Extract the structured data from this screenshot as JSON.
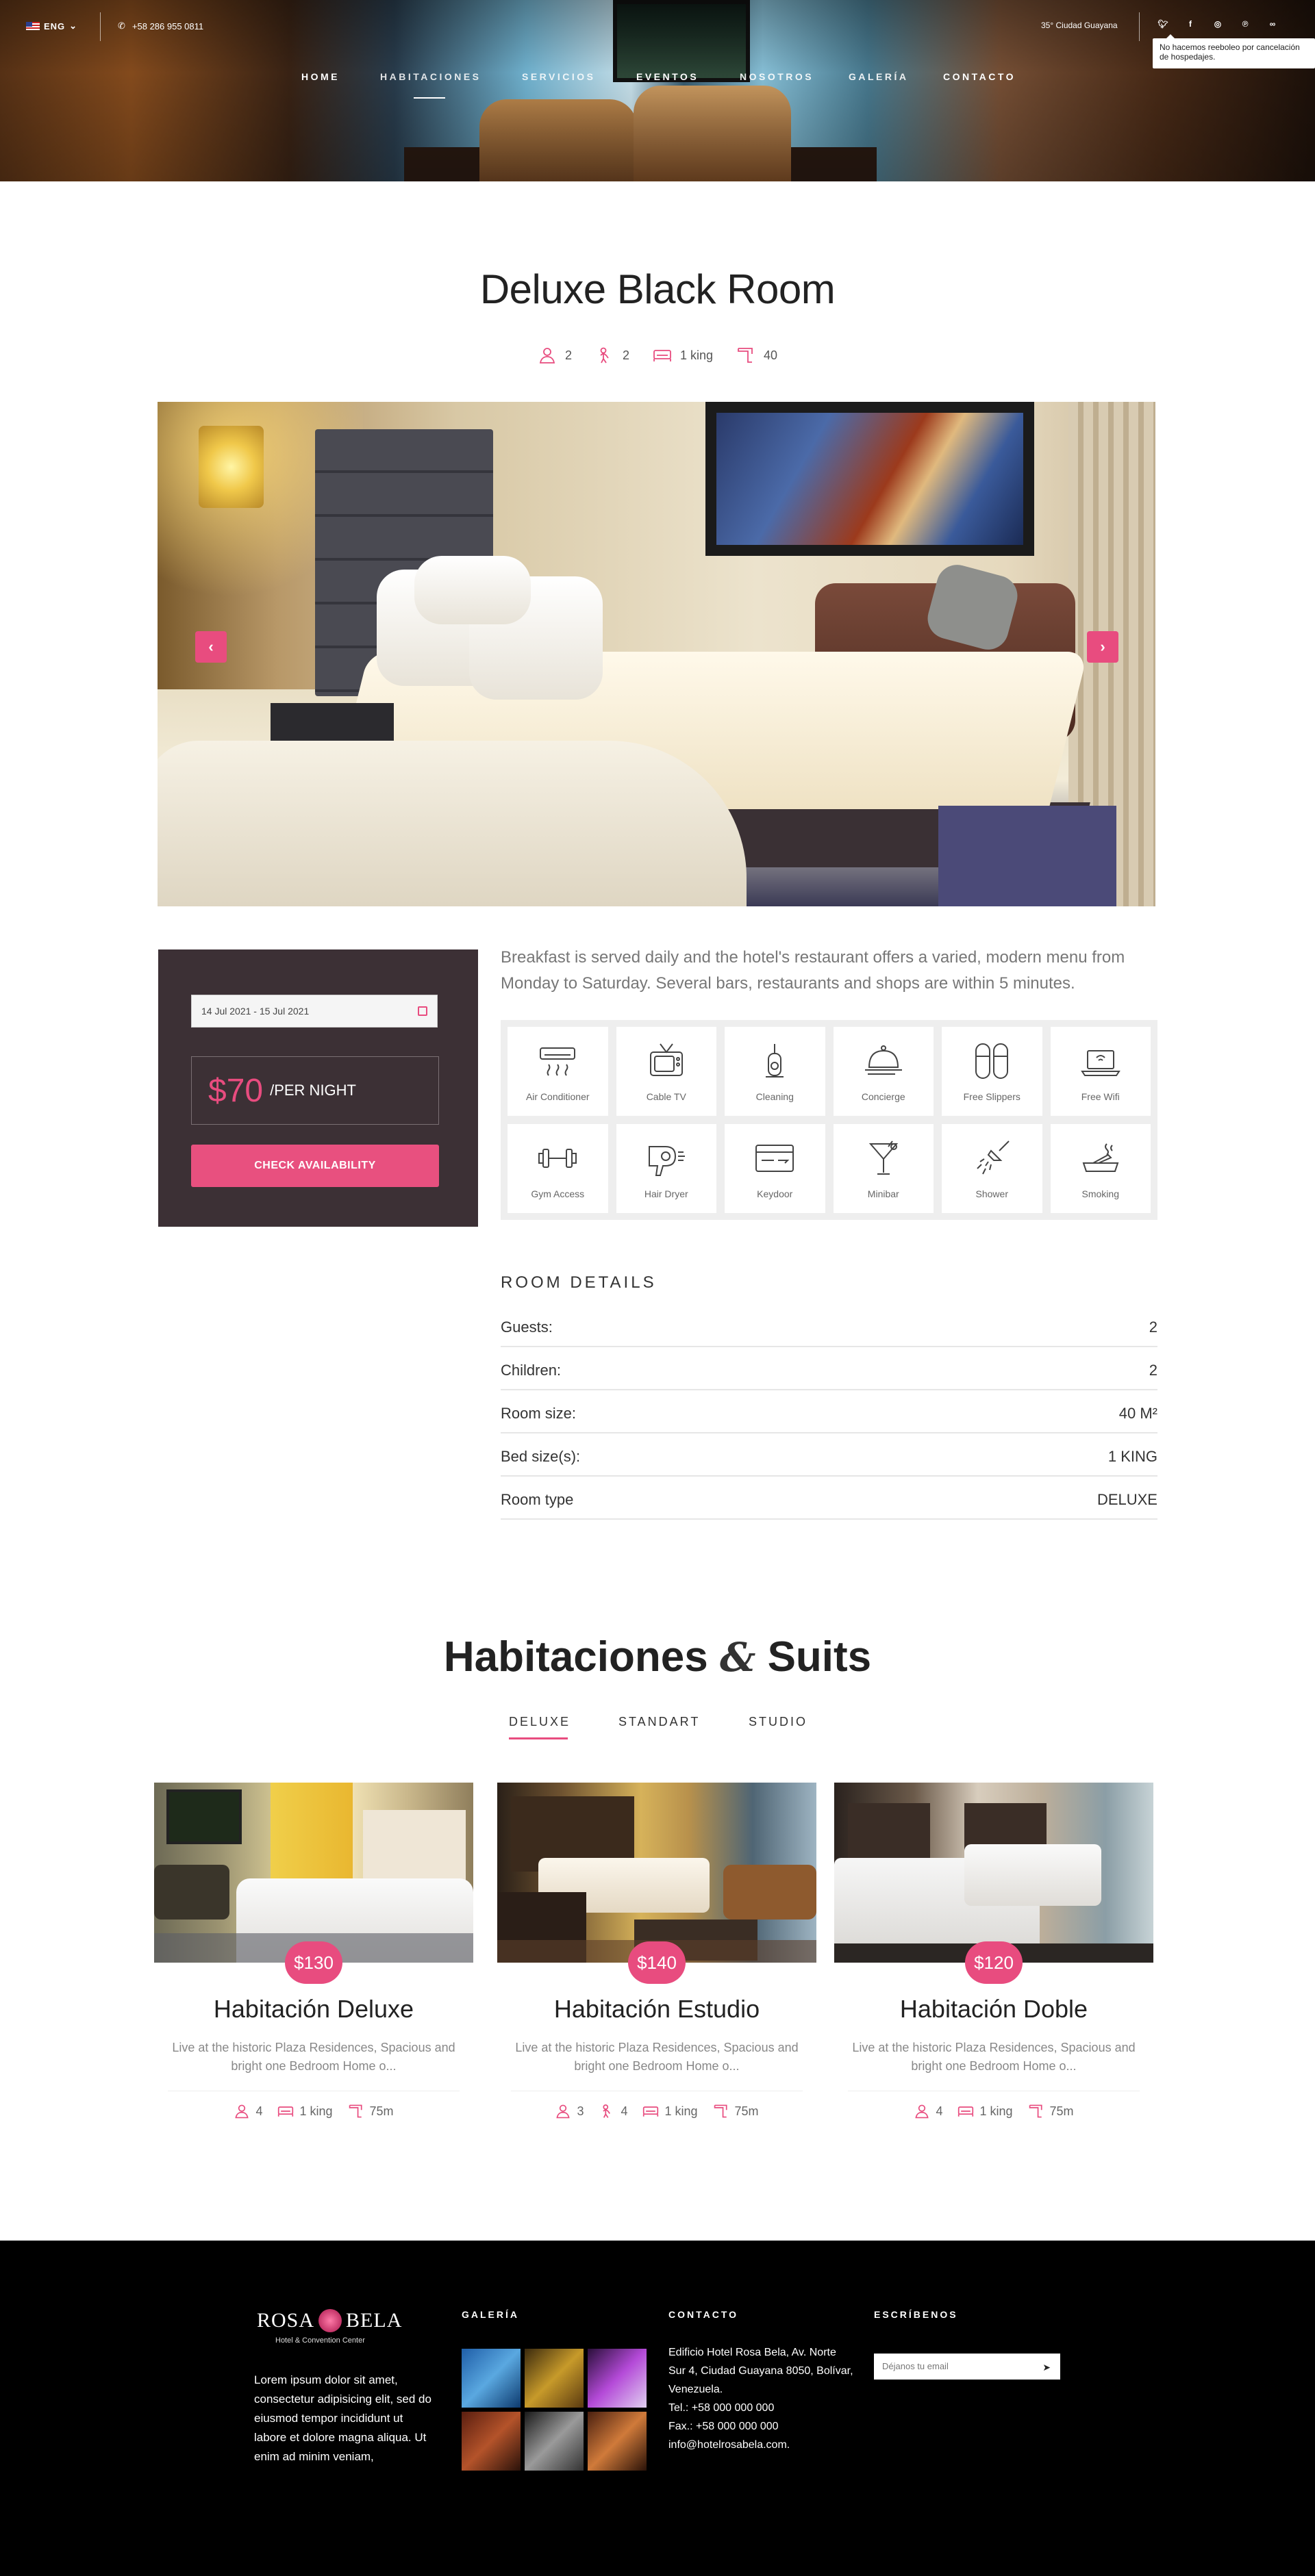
{
  "header": {
    "language": "ENG",
    "phone": "+58 286 955 0811",
    "weather": "35° Ciudad Guayana",
    "socials": [
      "twitter",
      "facebook",
      "instagram",
      "pinterest",
      "tripadvisor"
    ],
    "notice": "No hacemos reeboleo por cancelación de hospedajes.",
    "nav": [
      "HOME",
      "HABITACIONES",
      "SERVICIOS",
      "EVENTOS",
      "NOSOTROS",
      "GALERÍA",
      "CONTACTO"
    ],
    "active_nav": "HABITACIONES"
  },
  "room": {
    "title": "Deluxe Black Room",
    "guests": "2",
    "children": "2",
    "bed": "1 king",
    "size": "40"
  },
  "booking": {
    "date_range": "14 Jul 2021 - 15 Jul 2021",
    "price": "$70",
    "per_night": "/PER NIGHT",
    "button": "CHECK AVAILABILITY"
  },
  "description": "Breakfast is served daily and the hotel's restaurant offers a varied, modern menu from Monday to Saturday. Several bars, restaurants and shops are within 5 minutes.",
  "amenities": [
    "Air Conditioner",
    "Cable TV",
    "Cleaning",
    "Concierge",
    "Free Slippers",
    "Free Wifi",
    "Gym Access",
    "Hair Dryer",
    "Keydoor",
    "Minibar",
    "Shower",
    "Smoking"
  ],
  "room_details": {
    "title": "ROOM DETAILS",
    "rows": [
      {
        "label": "Guests:",
        "value": "2"
      },
      {
        "label": "Children:",
        "value": "2"
      },
      {
        "label": "Room size:",
        "value": "40 M²"
      },
      {
        "label": "Bed size(s):",
        "value": "1 KING"
      },
      {
        "label": "Room type",
        "value": "DELUXE"
      }
    ]
  },
  "rooms_section": {
    "title_a": "Habitaciones",
    "amp": "&",
    "title_b": "Suits",
    "tabs": [
      "DELUXE",
      "STANDART",
      "STUDIO"
    ],
    "cards": [
      {
        "price": "$130",
        "name": "Habitación Deluxe",
        "desc": "Live at the historic Plaza Residences, Spacious and bright one Bedroom Home o...",
        "guests": "4",
        "children": "",
        "bed": "1 king",
        "size": "75m"
      },
      {
        "price": "$140",
        "name": "Habitación Estudio",
        "desc": "Live at the historic Plaza Residences, Spacious and bright one Bedroom Home o...",
        "guests": "3",
        "children": "4",
        "bed": "1 king",
        "size": "75m"
      },
      {
        "price": "$120",
        "name": "Habitación  Doble",
        "desc": "Live at the historic Plaza Residences, Spacious and bright one Bedroom Home o...",
        "guests": "4",
        "children": "",
        "bed": "1 king",
        "size": "75m"
      }
    ]
  },
  "footer": {
    "logo_a": "ROSA",
    "logo_b": "BELA",
    "logo_sub": "Hotel & Convention Center",
    "about": "Lorem ipsum dolor sit amet, consectetur adipisicing elit, sed do eiusmod tempor incididunt ut labore et dolore magna aliqua. Ut enim ad minim veniam,",
    "gallery_title": "GALERÍA",
    "contact_title": "CONTACTO",
    "address": "Edificio Hotel Rosa Bela, Av. Norte Sur 4, Ciudad Guayana 8050, Bolívar, Venezuela.",
    "tel": "Tel.: +58 000 000 000",
    "fax": "Fax.: +58 000 000 000",
    "email": "info@hotelrosabela.com.",
    "write_title": "ESCRÍBENOS",
    "email_placeholder": "Déjanos tu email"
  },
  "colors": {
    "accent": "#e84c7f",
    "panel": "#3c3035",
    "footer": "#000000"
  }
}
